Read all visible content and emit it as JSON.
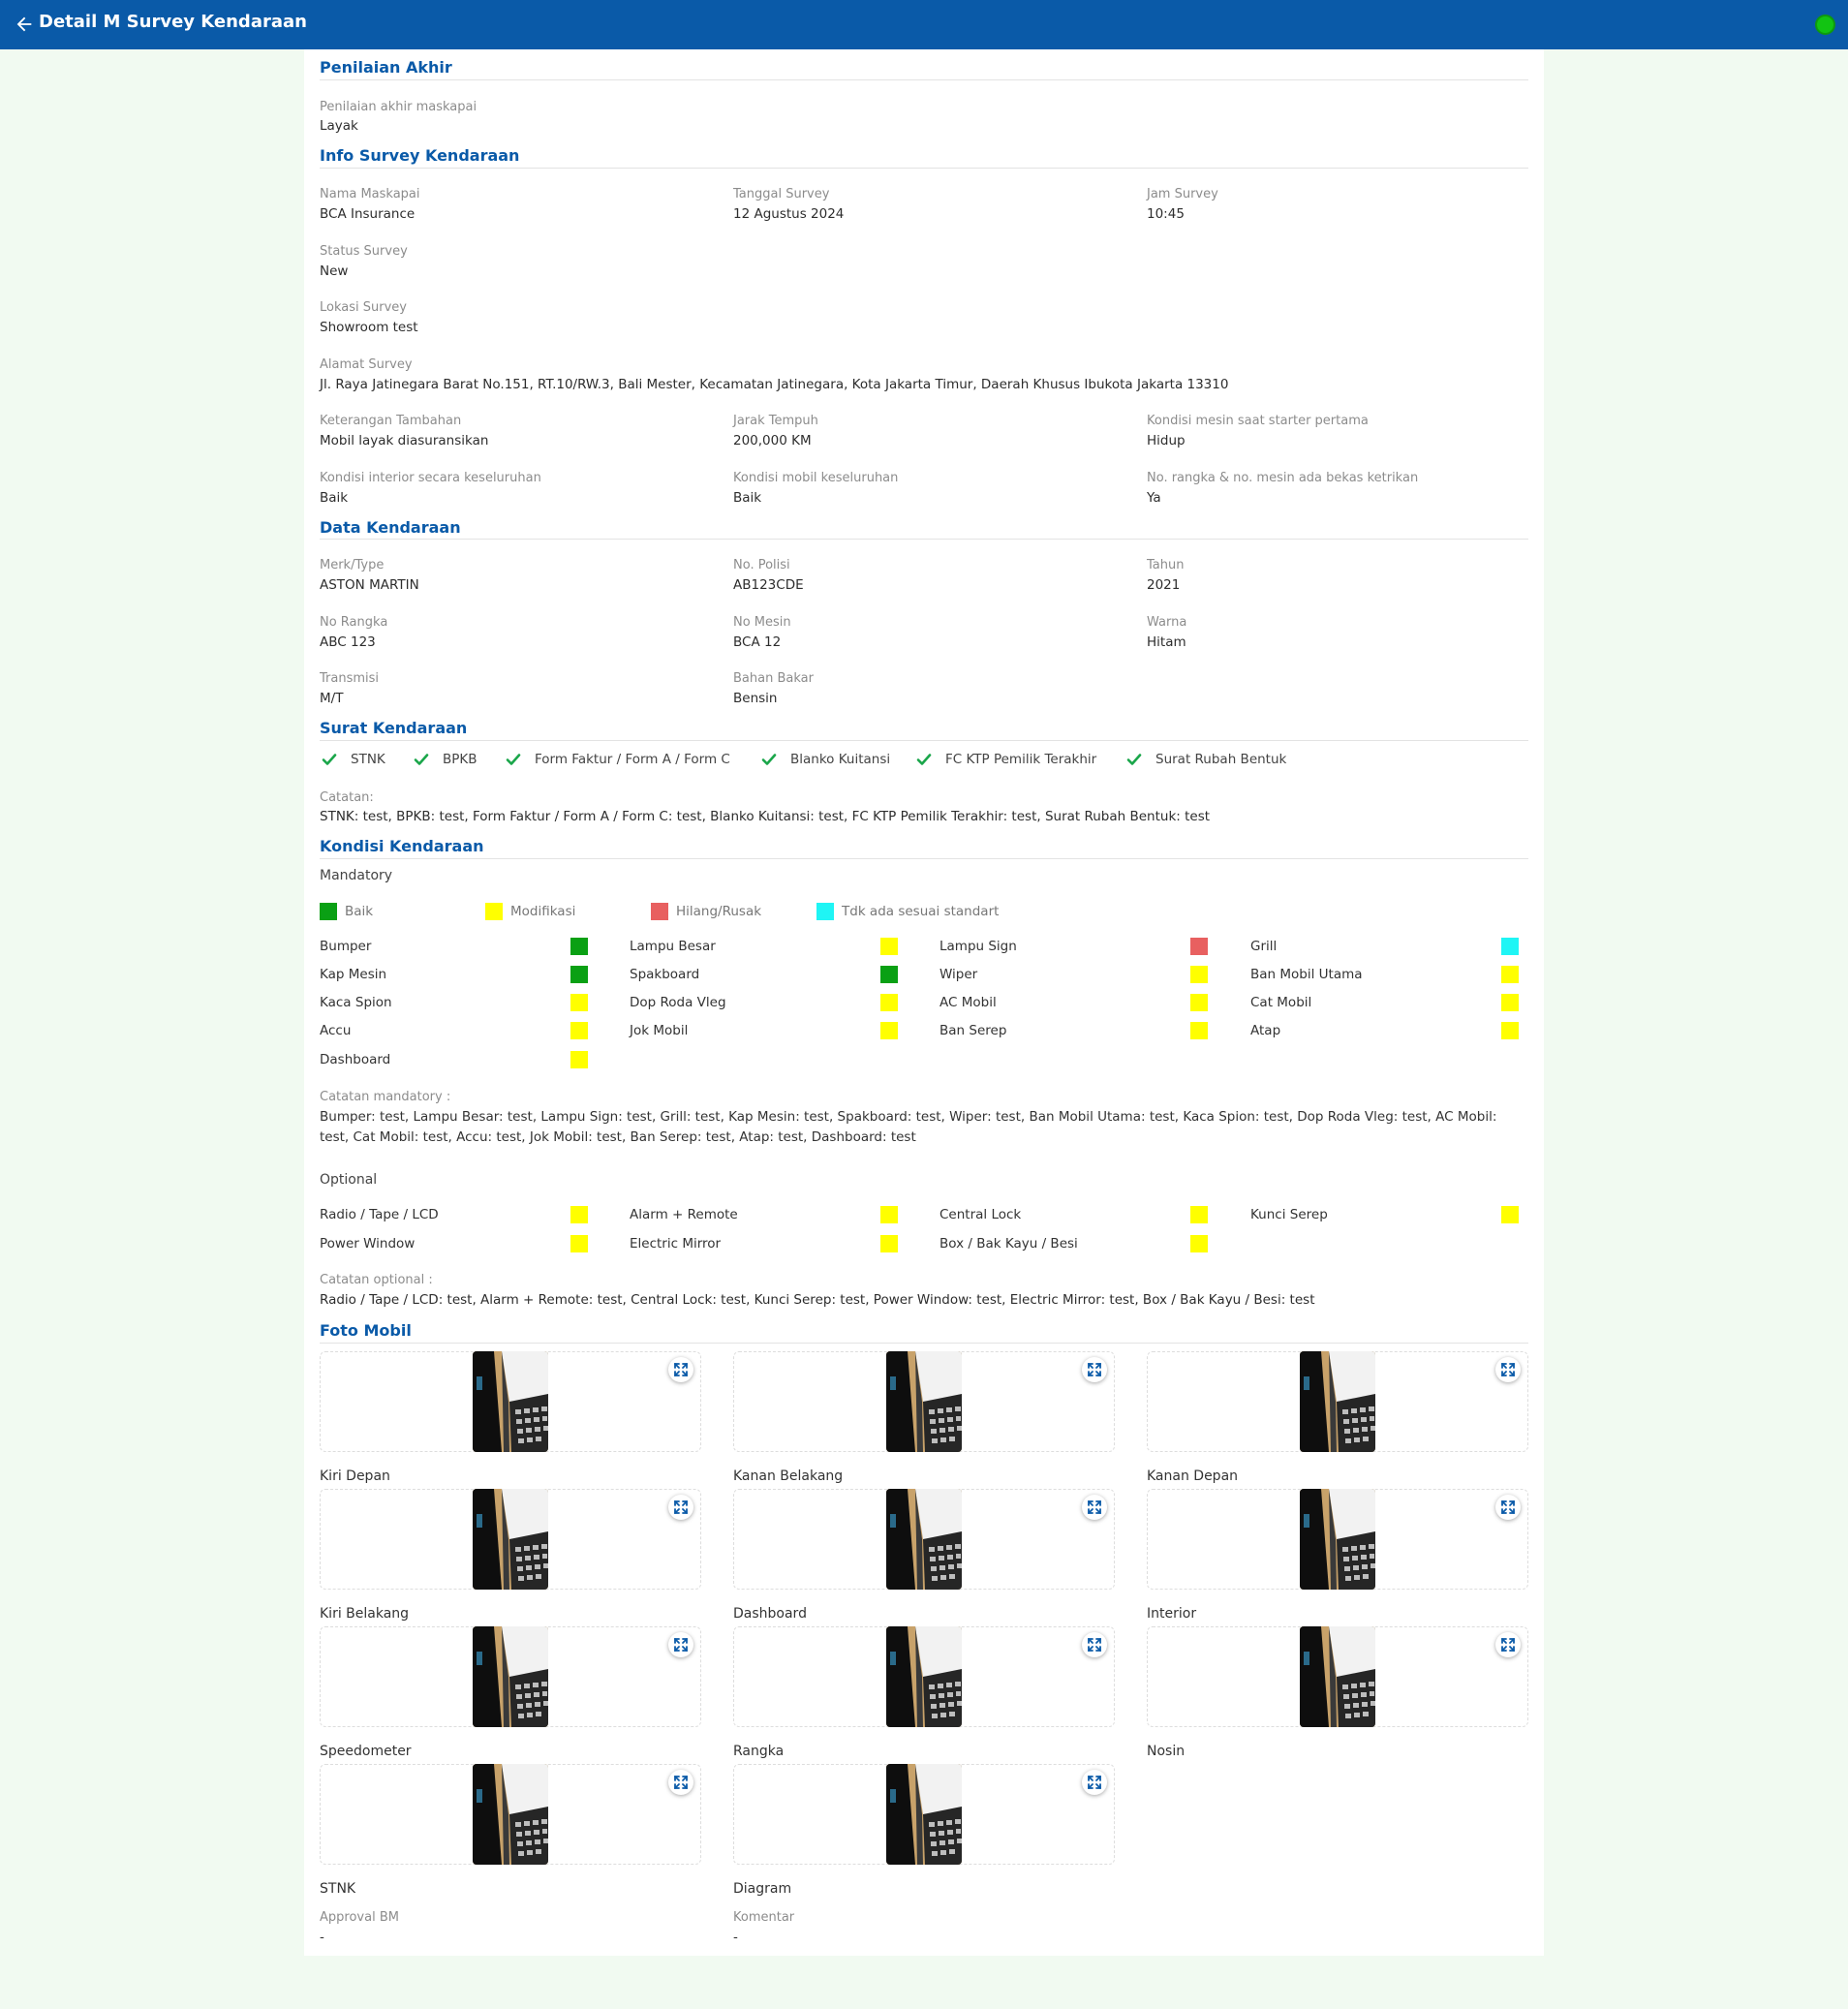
{
  "header": {
    "title": "Detail M Survey Kendaraan"
  },
  "colors": {
    "baik": "#0aa014",
    "modifikasi": "#ffff00",
    "hilang": "#e86060",
    "tdk": "#1ff5f5",
    "primary": "#0a5aa8"
  },
  "penilaian": {
    "title": "Penilaian Akhir",
    "label": "Penilaian akhir maskapai",
    "value": "Layak"
  },
  "info": {
    "title": "Info Survey Kendaraan",
    "fields": [
      {
        "label": "Nama Maskapai",
        "value": "BCA Insurance"
      },
      {
        "label": "Tanggal Survey",
        "value": "12 Agustus 2024"
      },
      {
        "label": "Jam Survey",
        "value": "10:45"
      },
      {
        "label": "Status Survey",
        "value": "New"
      },
      {
        "label": "Lokasi Survey",
        "value": "Showroom test"
      },
      {
        "label": "Alamat Survey",
        "value": "Jl. Raya Jatinegara Barat No.151, RT.10/RW.3, Bali Mester, Kecamatan Jatinegara, Kota Jakarta Timur, Daerah Khusus Ibukota Jakarta 13310"
      },
      {
        "label": "Keterangan Tambahan",
        "value": "Mobil layak diasuransikan"
      },
      {
        "label": "Jarak Tempuh",
        "value": "200,000 KM"
      },
      {
        "label": "Kondisi mesin saat starter pertama",
        "value": "Hidup"
      },
      {
        "label": "Kondisi interior secara keseluruhan",
        "value": "Baik"
      },
      {
        "label": "Kondisi mobil keseluruhan",
        "value": "Baik"
      },
      {
        "label": "No. rangka & no. mesin ada bekas ketrikan",
        "value": "Ya"
      }
    ]
  },
  "kendaraan": {
    "title": "Data Kendaraan",
    "fields": [
      {
        "label": "Merk/Type",
        "value": "ASTON MARTIN"
      },
      {
        "label": "No. Polisi",
        "value": "AB123CDE"
      },
      {
        "label": "Tahun",
        "value": "2021"
      },
      {
        "label": "No Rangka",
        "value": "ABC 123"
      },
      {
        "label": "No Mesin",
        "value": "BCA 12"
      },
      {
        "label": "Warna",
        "value": "Hitam"
      },
      {
        "label": "Transmisi",
        "value": "M/T"
      },
      {
        "label": "Bahan Bakar",
        "value": "Bensin"
      }
    ]
  },
  "surat": {
    "title": "Surat Kendaraan",
    "items": [
      "STNK",
      "BPKB",
      "Form Faktur / Form A / Form C",
      "Blanko Kuitansi",
      "FC KTP Pemilik Terakhir",
      "Surat Rubah Bentuk"
    ],
    "note_label": "Catatan:",
    "note": "STNK: test, BPKB: test, Form Faktur / Form A / Form C: test, Blanko Kuitansi: test, FC KTP Pemilik Terakhir: test, Surat Rubah Bentuk: test"
  },
  "kondisi": {
    "title": "Kondisi Kendaraan",
    "mandatory_title": "Mandatory",
    "legend": [
      {
        "label": "Baik",
        "status": "baik"
      },
      {
        "label": "Modifikasi",
        "status": "modifikasi"
      },
      {
        "label": "Hilang/Rusak",
        "status": "hilang"
      },
      {
        "label": "Tdk ada sesuai standart",
        "status": "tdk"
      }
    ],
    "mandatory": [
      {
        "label": "Bumper",
        "status": "baik"
      },
      {
        "label": "Lampu Besar",
        "status": "modifikasi"
      },
      {
        "label": "Lampu Sign",
        "status": "hilang"
      },
      {
        "label": "Grill",
        "status": "tdk"
      },
      {
        "label": "Kap Mesin",
        "status": "baik"
      },
      {
        "label": "Spakboard",
        "status": "baik"
      },
      {
        "label": "Wiper",
        "status": "modifikasi"
      },
      {
        "label": "Ban Mobil Utama",
        "status": "modifikasi"
      },
      {
        "label": "Kaca Spion",
        "status": "modifikasi"
      },
      {
        "label": "Dop Roda Vleg",
        "status": "modifikasi"
      },
      {
        "label": "AC Mobil",
        "status": "modifikasi"
      },
      {
        "label": "Cat Mobil",
        "status": "modifikasi"
      },
      {
        "label": "Accu",
        "status": "modifikasi"
      },
      {
        "label": "Jok Mobil",
        "status": "modifikasi"
      },
      {
        "label": "Ban Serep",
        "status": "modifikasi"
      },
      {
        "label": "Atap",
        "status": "modifikasi"
      },
      {
        "label": "Dashboard",
        "status": "modifikasi"
      }
    ],
    "mandatory_note_label": "Catatan mandatory :",
    "mandatory_note": "Bumper: test, Lampu Besar: test, Lampu Sign: test, Grill: test, Kap Mesin: test, Spakboard: test, Wiper: test, Ban Mobil Utama: test, Kaca Spion: test, Dop Roda Vleg: test, AC Mobil: test, Cat Mobil: test, Accu: test, Jok Mobil: test, Ban Serep: test, Atap: test, Dashboard: test",
    "optional_title": "Optional",
    "optional": [
      {
        "label": "Radio / Tape / LCD",
        "status": "modifikasi"
      },
      {
        "label": "Alarm + Remote",
        "status": "modifikasi"
      },
      {
        "label": "Central Lock",
        "status": "modifikasi"
      },
      {
        "label": "Kunci Serep",
        "status": "modifikasi"
      },
      {
        "label": "Power Window",
        "status": "modifikasi"
      },
      {
        "label": "Electric Mirror",
        "status": "modifikasi"
      },
      {
        "label": "Box / Bak Kayu / Besi",
        "status": "modifikasi"
      }
    ],
    "optional_note_label": "Catatan optional :",
    "optional_note": "Radio / Tape / LCD: test, Alarm + Remote: test, Central Lock: test, Kunci Serep: test, Power Window: test, Electric Mirror: test, Box / Bak Kayu / Besi: test"
  },
  "foto": {
    "title": "Foto Mobil",
    "photos": [
      "Kiri Depan",
      "Kanan Belakang",
      "Kanan Depan",
      "Kiri Belakang",
      "Dashboard",
      "Interior",
      "Speedometer",
      "Rangka",
      "Nosin",
      "STNK",
      "Diagram"
    ]
  },
  "approval": {
    "label": "Approval BM",
    "value": "-"
  },
  "komentar": {
    "label": "Komentar",
    "value": "-"
  }
}
